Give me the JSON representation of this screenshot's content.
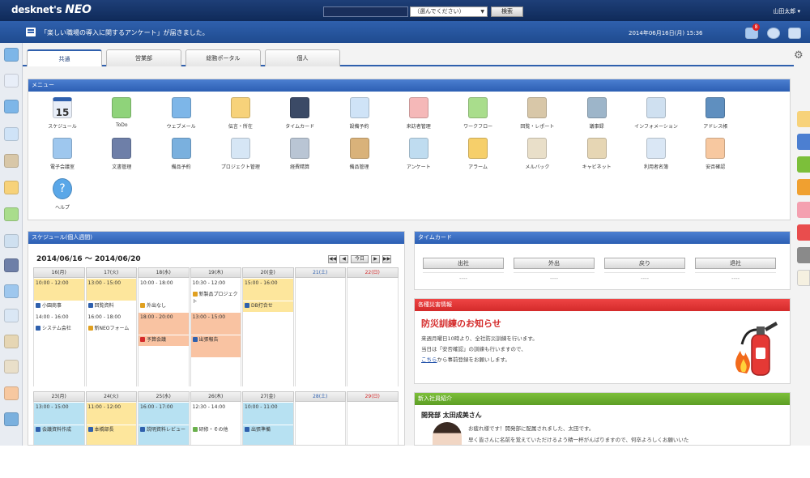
{
  "header": {
    "logo_text": "desknet's",
    "logo_neo": "NEO",
    "search_select": "（選んでください）",
    "search_button": "検索",
    "user_menu": "山田太郎 ▾"
  },
  "notice_bar": {
    "text": "「楽しい職場の導入に関するアンケート」が届きました。",
    "datetime": "2014年06月16日(月) 15:36",
    "badge": "8"
  },
  "tabs": [
    {
      "label": "共通",
      "active": true
    },
    {
      "label": "営業部",
      "active": false
    },
    {
      "label": "総務ポータル",
      "active": false
    },
    {
      "label": "個人",
      "active": false
    }
  ],
  "menu": {
    "title": "メニュー",
    "items": [
      {
        "label": "スケジュール",
        "color": "#e8eef8",
        "icon": "calendar-icon"
      },
      {
        "label": "ToDo",
        "color": "#8fd37a",
        "icon": "todo-icon"
      },
      {
        "label": "ウェブメール",
        "color": "#7db6e8",
        "icon": "webmail-icon"
      },
      {
        "label": "伝言・所在",
        "color": "#f7d27a",
        "icon": "message-icon"
      },
      {
        "label": "タイムカード",
        "color": "#3b4a66",
        "icon": "timecard-icon"
      },
      {
        "label": "設備予約",
        "color": "#cfe3f7",
        "icon": "facility-icon"
      },
      {
        "label": "来訪者管理",
        "color": "#f5b8b8",
        "icon": "visitor-icon"
      },
      {
        "label": "ワークフロー",
        "color": "#a9dd8c",
        "icon": "workflow-icon"
      },
      {
        "label": "回覧・レポート",
        "color": "#d8c7a8",
        "icon": "report-icon"
      },
      {
        "label": "議事録",
        "color": "#9db5c9",
        "icon": "minutes-icon"
      },
      {
        "label": "インフォメーション",
        "color": "#cfe0f0",
        "icon": "information-icon"
      },
      {
        "label": "アドレス帳",
        "color": "#5f8fbf",
        "icon": "addressbook-icon"
      },
      {
        "label": "電子会議室",
        "color": "#9ec7ee",
        "icon": "forum-icon"
      },
      {
        "label": "文書管理",
        "color": "#6e7fa8",
        "icon": "document-icon"
      },
      {
        "label": "備品予約",
        "color": "#7ab0de",
        "icon": "equipment-icon"
      },
      {
        "label": "プロジェクト管理",
        "color": "#d6e6f5",
        "icon": "project-icon"
      },
      {
        "label": "経費精算",
        "color": "#b9c5d4",
        "icon": "expense-icon"
      },
      {
        "label": "備品管理",
        "color": "#d9b27a",
        "icon": "stock-icon"
      },
      {
        "label": "アンケート",
        "color": "#bfdcf0",
        "icon": "survey-icon"
      },
      {
        "label": "アラーム",
        "color": "#f6cf6a",
        "icon": "alarm-icon"
      },
      {
        "label": "メルバック",
        "color": "#e9dfc9",
        "icon": "notebook-icon"
      },
      {
        "label": "キャビネット",
        "color": "#e6d6b4",
        "icon": "cabinet-icon"
      },
      {
        "label": "利用者名簿",
        "color": "#dae7f5",
        "icon": "roster-icon"
      },
      {
        "label": "安否確認",
        "color": "#f7c8a0",
        "icon": "safety-icon"
      },
      {
        "label": "ヘルプ",
        "color": "#5aa7e8",
        "icon": "help-icon"
      }
    ]
  },
  "schedule": {
    "title": "スケジュール(個人週間)",
    "range": "2014/06/16 ～ 2014/06/20",
    "pager": [
      "◀◀",
      "◀",
      "今日",
      "▶",
      "▶▶"
    ],
    "week1": {
      "days": [
        {
          "label": "16(月)",
          "kind": "weekday"
        },
        {
          "label": "17(火)",
          "kind": "weekday"
        },
        {
          "label": "18(水)",
          "kind": "weekday"
        },
        {
          "label": "19(木)",
          "kind": "weekday"
        },
        {
          "label": "20(金)",
          "kind": "weekday"
        },
        {
          "label": "21(土)",
          "kind": "sat"
        },
        {
          "label": "22(日)",
          "kind": "sun"
        }
      ],
      "events": [
        {
          "day": 0,
          "slot": 0,
          "h": 2,
          "c": "y",
          "text": "10:00 - 12:00"
        },
        {
          "day": 0,
          "slot": 2,
          "h": 1,
          "c": "w",
          "mark": "#2f60ad",
          "text": "小園商事"
        },
        {
          "day": 0,
          "slot": 3,
          "h": 1,
          "c": "w",
          "text": "14:00 - 16:00"
        },
        {
          "day": 0,
          "slot": 4,
          "h": 2,
          "c": "w",
          "mark": "#2f60ad",
          "text": "システム会社"
        },
        {
          "day": 1,
          "slot": 0,
          "h": 2,
          "c": "y",
          "text": "13:00 - 15:00"
        },
        {
          "day": 1,
          "slot": 2,
          "h": 1,
          "c": "w",
          "mark": "#2f60ad",
          "text": "回覧資料"
        },
        {
          "day": 1,
          "slot": 3,
          "h": 1,
          "c": "w",
          "text": "16:00 - 18:00"
        },
        {
          "day": 1,
          "slot": 4,
          "h": 2,
          "c": "w",
          "mark": "#e0a020",
          "text": "新NEOフォーム"
        },
        {
          "day": 2,
          "slot": 0,
          "h": 2,
          "c": "w",
          "text": "10:00 - 18:00"
        },
        {
          "day": 2,
          "slot": 2,
          "h": 1,
          "c": "w",
          "mark": "#e0a020",
          "text": "外出なし"
        },
        {
          "day": 2,
          "slot": 3,
          "h": 2,
          "c": "o",
          "text": "18:00 - 20:00"
        },
        {
          "day": 2,
          "slot": 5,
          "h": 1,
          "c": "o",
          "mark": "#d42b2b",
          "text": "予算会議"
        },
        {
          "day": 3,
          "slot": 0,
          "h": 1,
          "c": "w",
          "text": "10:30 - 12:00"
        },
        {
          "day": 3,
          "slot": 1,
          "h": 2,
          "c": "w",
          "mark": "#e0a020",
          "text": "新製品プロジェクト"
        },
        {
          "day": 3,
          "slot": 3,
          "h": 2,
          "c": "o",
          "text": "13:00 - 15:00"
        },
        {
          "day": 3,
          "slot": 5,
          "h": 2,
          "c": "o",
          "mark": "#2f60ad",
          "text": "出張報告"
        },
        {
          "day": 4,
          "slot": 0,
          "h": 2,
          "c": "y",
          "text": "15:00 - 16:00"
        },
        {
          "day": 4,
          "slot": 2,
          "h": 1,
          "c": "y",
          "mark": "#2f60ad",
          "text": "DB打合せ"
        }
      ]
    },
    "week2": {
      "days": [
        {
          "label": "23(月)",
          "kind": "weekday"
        },
        {
          "label": "24(火)",
          "kind": "weekday"
        },
        {
          "label": "25(水)",
          "kind": "weekday"
        },
        {
          "label": "26(木)",
          "kind": "weekday"
        },
        {
          "label": "27(金)",
          "kind": "weekday"
        },
        {
          "label": "28(土)",
          "kind": "sat"
        },
        {
          "label": "29(日)",
          "kind": "sun"
        }
      ],
      "events": [
        {
          "day": 0,
          "slot": 0,
          "h": 2,
          "c": "b",
          "text": "13:00 - 15:00"
        },
        {
          "day": 0,
          "slot": 2,
          "h": 2,
          "c": "b",
          "mark": "#2f60ad",
          "text": "会議資料作成"
        },
        {
          "day": 1,
          "slot": 0,
          "h": 2,
          "c": "y",
          "text": "11:00 - 12:00"
        },
        {
          "day": 1,
          "slot": 2,
          "h": 2,
          "c": "y",
          "mark": "#2f60ad",
          "text": "本橋部長"
        },
        {
          "day": 2,
          "slot": 0,
          "h": 2,
          "c": "b",
          "text": "16:00 - 17:00"
        },
        {
          "day": 2,
          "slot": 2,
          "h": 2,
          "c": "b",
          "mark": "#2f60ad",
          "text": "説明資料レビュー"
        },
        {
          "day": 3,
          "slot": 0,
          "h": 2,
          "c": "w",
          "text": "12:30 - 14:00"
        },
        {
          "day": 3,
          "slot": 2,
          "h": 2,
          "c": "w",
          "mark": "#6ab04c",
          "text": "研修・その他"
        },
        {
          "day": 4,
          "slot": 0,
          "h": 2,
          "c": "b",
          "text": "10:00 - 11:00"
        },
        {
          "day": 4,
          "slot": 2,
          "h": 2,
          "c": "b",
          "mark": "#2f60ad",
          "text": "出張準備"
        }
      ]
    }
  },
  "timecard": {
    "title": "タイムカード",
    "buttons": [
      "出社",
      "外出",
      "戻り",
      "退社"
    ],
    "values": [
      "----",
      "----",
      "----",
      "----"
    ]
  },
  "notices": {
    "title": "各種災害情報",
    "headline": "防災訓練のお知らせ",
    "lines": [
      "来週月曜日10時より、全社防災訓練を行います。",
      "当日は「安否確認」の訓練も行いますので、",
      "から事前登録をお願いします。"
    ],
    "link": "こちら"
  },
  "intro": {
    "title": "新入社員紹介",
    "name": "開発部 太田成美さん",
    "lines": [
      "お疲れ様です！開発部に配属されました、太田です。",
      "早く皆さんに名前を覚えていただけるよう精一杯がんばりますので、何卒よろしくお願いいた"
    ]
  },
  "colors": {
    "header": "#0f2a59",
    "notice_bar": "#2f60ad",
    "accent": "#2f60ad",
    "alert": "#d42b2b",
    "green": "#6ab04c"
  }
}
